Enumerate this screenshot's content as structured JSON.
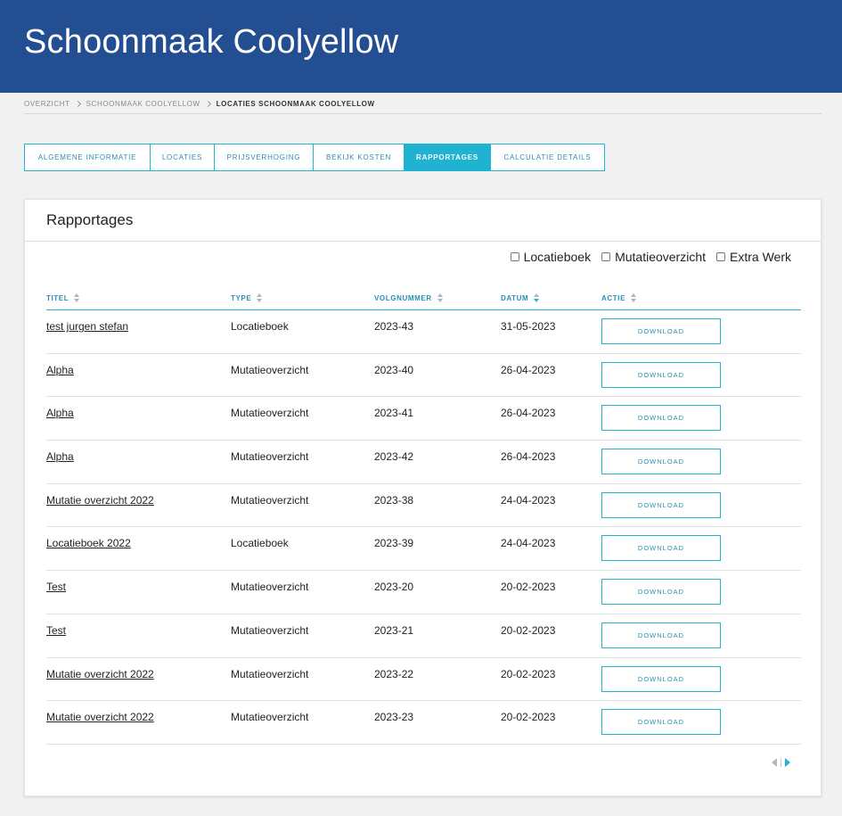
{
  "header": {
    "title": "Schoonmaak Coolyellow"
  },
  "breadcrumb": [
    "Overzicht",
    "Schoonmaak Coolyellow",
    "Locaties Schoonmaak Coolyellow"
  ],
  "tabs": [
    {
      "label": "Algemene informatie",
      "active": false
    },
    {
      "label": "Locaties",
      "active": false
    },
    {
      "label": "Prijsverhoging",
      "active": false
    },
    {
      "label": "Bekijk kosten",
      "active": false
    },
    {
      "label": "Rapportages",
      "active": true
    },
    {
      "label": "Calculatie details",
      "active": false
    }
  ],
  "card": {
    "title": "Rapportages"
  },
  "filters": [
    {
      "label": "Locatieboek",
      "checked": false
    },
    {
      "label": "Mutatieoverzicht",
      "checked": false
    },
    {
      "label": "Extra Werk",
      "checked": false
    }
  ],
  "table": {
    "columns": [
      "Titel",
      "Type",
      "Volgnummer",
      "Datum",
      "Actie"
    ],
    "sorted_column": "Datum",
    "sort_direction": "descending",
    "download_label": "Download",
    "rows": [
      {
        "titel": "test jurgen stefan",
        "type": "Locatieboek",
        "volgnummer": "2023-43",
        "datum": "31-05-2023"
      },
      {
        "titel": "Alpha",
        "type": "Mutatieoverzicht",
        "volgnummer": "2023-40",
        "datum": "26-04-2023"
      },
      {
        "titel": "Alpha",
        "type": "Mutatieoverzicht",
        "volgnummer": "2023-41",
        "datum": "26-04-2023"
      },
      {
        "titel": "Alpha",
        "type": "Mutatieoverzicht",
        "volgnummer": "2023-42",
        "datum": "26-04-2023"
      },
      {
        "titel": "Mutatie overzicht 2022",
        "type": "Mutatieoverzicht",
        "volgnummer": "2023-38",
        "datum": "24-04-2023"
      },
      {
        "titel": "Locatieboek 2022",
        "type": "Locatieboek",
        "volgnummer": "2023-39",
        "datum": "24-04-2023"
      },
      {
        "titel": "Test",
        "type": "Mutatieoverzicht",
        "volgnummer": "2023-20",
        "datum": "20-02-2023"
      },
      {
        "titel": "Test",
        "type": "Mutatieoverzicht",
        "volgnummer": "2023-21",
        "datum": "20-02-2023"
      },
      {
        "titel": "Mutatie overzicht 2022",
        "type": "Mutatieoverzicht",
        "volgnummer": "2023-22",
        "datum": "20-02-2023"
      },
      {
        "titel": "Mutatie overzicht 2022",
        "type": "Mutatieoverzicht",
        "volgnummer": "2023-23",
        "datum": "20-02-2023"
      }
    ]
  },
  "pagination": {
    "prev_icon": "caret-left-icon",
    "next_icon": "caret-right-icon"
  },
  "colors": {
    "header_bg": "#234e92",
    "accent": "#1fb2d1",
    "page_bg": "#f1f1f1"
  }
}
